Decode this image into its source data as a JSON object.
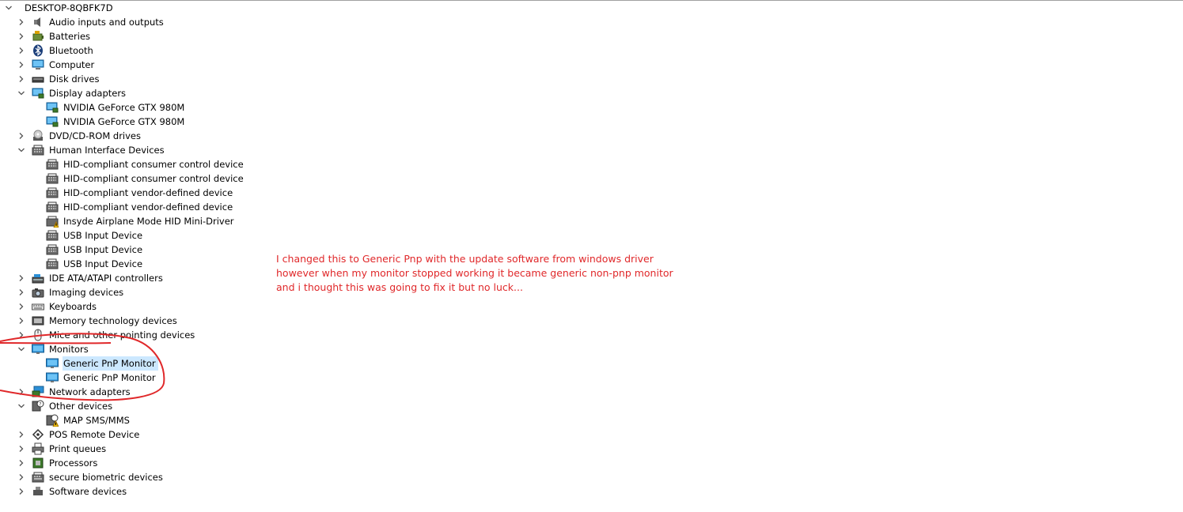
{
  "root": {
    "label": "DESKTOP-8QBFK7D",
    "expanded": true
  },
  "tree": [
    {
      "level": 1,
      "label": "Audio inputs and outputs",
      "icon": "speaker-icon",
      "expanded": false
    },
    {
      "level": 1,
      "label": "Batteries",
      "icon": "battery-icon",
      "expanded": false
    },
    {
      "level": 1,
      "label": "Bluetooth",
      "icon": "bluetooth-icon",
      "expanded": false
    },
    {
      "level": 1,
      "label": "Computer",
      "icon": "computer-icon",
      "expanded": false
    },
    {
      "level": 1,
      "label": "Disk drives",
      "icon": "disk-drive-icon",
      "expanded": false
    },
    {
      "level": 1,
      "label": "Display adapters",
      "icon": "display-adapter-icon",
      "expanded": true
    },
    {
      "level": 2,
      "label": "NVIDIA GeForce GTX 980M",
      "icon": "display-adapter-icon"
    },
    {
      "level": 2,
      "label": "NVIDIA GeForce GTX 980M",
      "icon": "display-adapter-icon"
    },
    {
      "level": 1,
      "label": "DVD/CD-ROM drives",
      "icon": "dvd-drive-icon",
      "expanded": false
    },
    {
      "level": 1,
      "label": "Human Interface Devices",
      "icon": "hid-icon",
      "expanded": true
    },
    {
      "level": 2,
      "label": "HID-compliant consumer control device",
      "icon": "hid-icon"
    },
    {
      "level": 2,
      "label": "HID-compliant consumer control device",
      "icon": "hid-icon"
    },
    {
      "level": 2,
      "label": "HID-compliant vendor-defined device",
      "icon": "hid-icon"
    },
    {
      "level": 2,
      "label": "HID-compliant vendor-defined device",
      "icon": "hid-icon"
    },
    {
      "level": 2,
      "label": "Insyde Airplane Mode HID Mini-Driver",
      "icon": "hid-warning-icon"
    },
    {
      "level": 2,
      "label": "USB Input Device",
      "icon": "hid-icon"
    },
    {
      "level": 2,
      "label": "USB Input Device",
      "icon": "hid-icon"
    },
    {
      "level": 2,
      "label": "USB Input Device",
      "icon": "hid-icon"
    },
    {
      "level": 1,
      "label": "IDE ATA/ATAPI controllers",
      "icon": "ide-controller-icon",
      "expanded": false
    },
    {
      "level": 1,
      "label": "Imaging devices",
      "icon": "camera-icon",
      "expanded": false
    },
    {
      "level": 1,
      "label": "Keyboards",
      "icon": "keyboard-icon",
      "expanded": false
    },
    {
      "level": 1,
      "label": "Memory technology devices",
      "icon": "memory-device-icon",
      "expanded": false
    },
    {
      "level": 1,
      "label": "Mice and other pointing devices",
      "icon": "mouse-icon",
      "expanded": false
    },
    {
      "level": 1,
      "label": "Monitors",
      "icon": "monitor-icon",
      "expanded": true
    },
    {
      "level": 2,
      "label": "Generic PnP Monitor",
      "icon": "monitor-icon",
      "selected": true
    },
    {
      "level": 2,
      "label": "Generic PnP Monitor",
      "icon": "monitor-icon"
    },
    {
      "level": 1,
      "label": "Network adapters",
      "icon": "network-adapter-icon",
      "expanded": false
    },
    {
      "level": 1,
      "label": "Other devices",
      "icon": "unknown-device-icon",
      "expanded": true
    },
    {
      "level": 2,
      "label": "MAP SMS/MMS",
      "icon": "unknown-device-warning-icon"
    },
    {
      "level": 1,
      "label": "POS Remote Device",
      "icon": "pos-device-icon",
      "expanded": false
    },
    {
      "level": 1,
      "label": "Print queues",
      "icon": "printer-icon",
      "expanded": false
    },
    {
      "level": 1,
      "label": "Processors",
      "icon": "processor-icon",
      "expanded": false
    },
    {
      "level": 1,
      "label": "secure biometric devices",
      "icon": "biometric-icon",
      "expanded": false
    },
    {
      "level": 1,
      "label": "Software devices",
      "icon": "software-device-icon",
      "expanded": false
    }
  ],
  "annotation": {
    "lines": [
      "I changed this to Generic Pnp with the update software from windows driver",
      "however when my monitor stopped working it became generic non-pnp monitor",
      "and i thought this was going to fix it but no luck..."
    ],
    "color": "#e0282a"
  },
  "colors": {
    "selection": "#cce8ff",
    "chevron": "#555555"
  }
}
